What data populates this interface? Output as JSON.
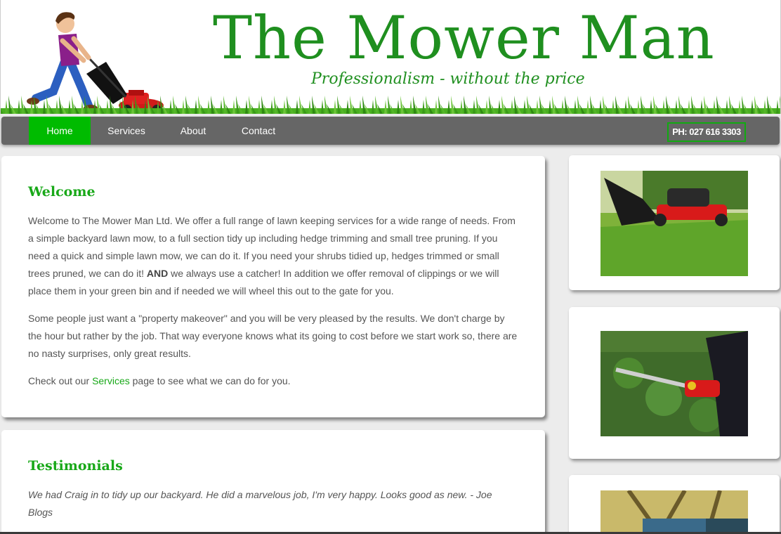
{
  "header": {
    "title": "The Mower Man",
    "tagline": "Professionalism - without the price"
  },
  "nav": {
    "items": [
      {
        "label": "Home"
      },
      {
        "label": "Services"
      },
      {
        "label": "About"
      },
      {
        "label": "Contact"
      }
    ],
    "phone": "PH: 027 616 3303"
  },
  "welcome": {
    "heading": "Welcome",
    "p1_a": "Welcome to The Mower Man Ltd. We offer a full range of lawn keeping services for a wide range of needs. From a simple backyard lawn mow, to a full section tidy up including hedge trimming and small tree pruning. If you need a quick and simple lawn mow, we can do it. If you need your shrubs tidied up, hedges trimmed or small trees pruned, we can do it!",
    "p1_strong": "AND",
    "p1_b": "we always use a catcher! In addition we offer removal of clippings or we will place them in your green bin and if needed we will wheel this out to the gate for you.",
    "p2": "Some people just want a \"property makeover\" and you will be very pleased by the results. We don't charge by the hour but rather by the job. That way everyone knows what its going to cost before we start work so, there are no nasty surprises, only great results.",
    "p3_a": "Check out our",
    "p3_link": "Services",
    "p3_b": "page to see what we can do for you."
  },
  "testimonials": {
    "heading": "Testimonials",
    "quote": "We had Craig in to tidy up our backyard. He did a marvelous job, I'm very happy. Looks good as new. - Joe Blogs"
  },
  "colors": {
    "brand_green": "#1f8f1f",
    "nav_bg": "#666666",
    "nav_active": "#00bb00"
  }
}
